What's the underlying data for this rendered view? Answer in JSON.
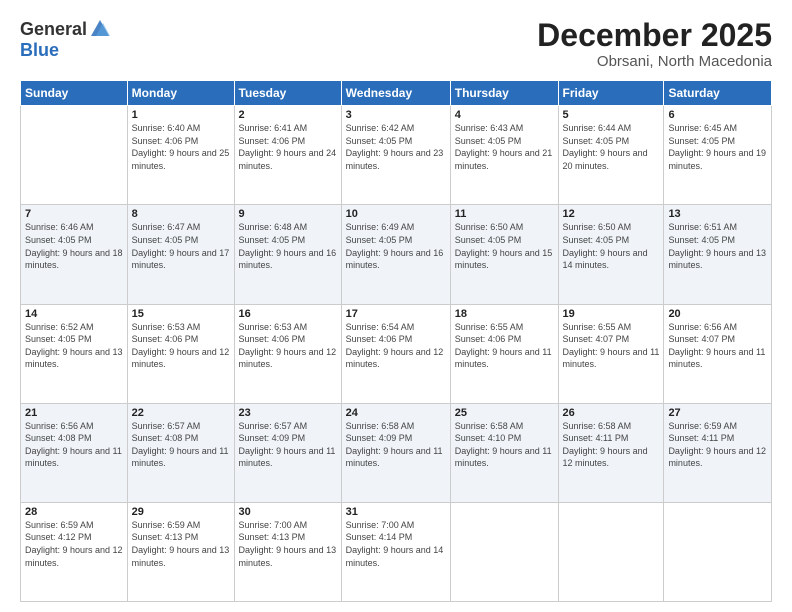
{
  "logo": {
    "general": "General",
    "blue": "Blue"
  },
  "header": {
    "month": "December 2025",
    "location": "Obrsani, North Macedonia"
  },
  "days_of_week": [
    "Sunday",
    "Monday",
    "Tuesday",
    "Wednesday",
    "Thursday",
    "Friday",
    "Saturday"
  ],
  "weeks": [
    [
      {
        "day": "",
        "sunrise": "",
        "sunset": "",
        "daylight": ""
      },
      {
        "day": "1",
        "sunrise": "Sunrise: 6:40 AM",
        "sunset": "Sunset: 4:06 PM",
        "daylight": "Daylight: 9 hours and 25 minutes."
      },
      {
        "day": "2",
        "sunrise": "Sunrise: 6:41 AM",
        "sunset": "Sunset: 4:06 PM",
        "daylight": "Daylight: 9 hours and 24 minutes."
      },
      {
        "day": "3",
        "sunrise": "Sunrise: 6:42 AM",
        "sunset": "Sunset: 4:05 PM",
        "daylight": "Daylight: 9 hours and 23 minutes."
      },
      {
        "day": "4",
        "sunrise": "Sunrise: 6:43 AM",
        "sunset": "Sunset: 4:05 PM",
        "daylight": "Daylight: 9 hours and 21 minutes."
      },
      {
        "day": "5",
        "sunrise": "Sunrise: 6:44 AM",
        "sunset": "Sunset: 4:05 PM",
        "daylight": "Daylight: 9 hours and 20 minutes."
      },
      {
        "day": "6",
        "sunrise": "Sunrise: 6:45 AM",
        "sunset": "Sunset: 4:05 PM",
        "daylight": "Daylight: 9 hours and 19 minutes."
      }
    ],
    [
      {
        "day": "7",
        "sunrise": "Sunrise: 6:46 AM",
        "sunset": "Sunset: 4:05 PM",
        "daylight": "Daylight: 9 hours and 18 minutes."
      },
      {
        "day": "8",
        "sunrise": "Sunrise: 6:47 AM",
        "sunset": "Sunset: 4:05 PM",
        "daylight": "Daylight: 9 hours and 17 minutes."
      },
      {
        "day": "9",
        "sunrise": "Sunrise: 6:48 AM",
        "sunset": "Sunset: 4:05 PM",
        "daylight": "Daylight: 9 hours and 16 minutes."
      },
      {
        "day": "10",
        "sunrise": "Sunrise: 6:49 AM",
        "sunset": "Sunset: 4:05 PM",
        "daylight": "Daylight: 9 hours and 16 minutes."
      },
      {
        "day": "11",
        "sunrise": "Sunrise: 6:50 AM",
        "sunset": "Sunset: 4:05 PM",
        "daylight": "Daylight: 9 hours and 15 minutes."
      },
      {
        "day": "12",
        "sunrise": "Sunrise: 6:50 AM",
        "sunset": "Sunset: 4:05 PM",
        "daylight": "Daylight: 9 hours and 14 minutes."
      },
      {
        "day": "13",
        "sunrise": "Sunrise: 6:51 AM",
        "sunset": "Sunset: 4:05 PM",
        "daylight": "Daylight: 9 hours and 13 minutes."
      }
    ],
    [
      {
        "day": "14",
        "sunrise": "Sunrise: 6:52 AM",
        "sunset": "Sunset: 4:05 PM",
        "daylight": "Daylight: 9 hours and 13 minutes."
      },
      {
        "day": "15",
        "sunrise": "Sunrise: 6:53 AM",
        "sunset": "Sunset: 4:06 PM",
        "daylight": "Daylight: 9 hours and 12 minutes."
      },
      {
        "day": "16",
        "sunrise": "Sunrise: 6:53 AM",
        "sunset": "Sunset: 4:06 PM",
        "daylight": "Daylight: 9 hours and 12 minutes."
      },
      {
        "day": "17",
        "sunrise": "Sunrise: 6:54 AM",
        "sunset": "Sunset: 4:06 PM",
        "daylight": "Daylight: 9 hours and 12 minutes."
      },
      {
        "day": "18",
        "sunrise": "Sunrise: 6:55 AM",
        "sunset": "Sunset: 4:06 PM",
        "daylight": "Daylight: 9 hours and 11 minutes."
      },
      {
        "day": "19",
        "sunrise": "Sunrise: 6:55 AM",
        "sunset": "Sunset: 4:07 PM",
        "daylight": "Daylight: 9 hours and 11 minutes."
      },
      {
        "day": "20",
        "sunrise": "Sunrise: 6:56 AM",
        "sunset": "Sunset: 4:07 PM",
        "daylight": "Daylight: 9 hours and 11 minutes."
      }
    ],
    [
      {
        "day": "21",
        "sunrise": "Sunrise: 6:56 AM",
        "sunset": "Sunset: 4:08 PM",
        "daylight": "Daylight: 9 hours and 11 minutes."
      },
      {
        "day": "22",
        "sunrise": "Sunrise: 6:57 AM",
        "sunset": "Sunset: 4:08 PM",
        "daylight": "Daylight: 9 hours and 11 minutes."
      },
      {
        "day": "23",
        "sunrise": "Sunrise: 6:57 AM",
        "sunset": "Sunset: 4:09 PM",
        "daylight": "Daylight: 9 hours and 11 minutes."
      },
      {
        "day": "24",
        "sunrise": "Sunrise: 6:58 AM",
        "sunset": "Sunset: 4:09 PM",
        "daylight": "Daylight: 9 hours and 11 minutes."
      },
      {
        "day": "25",
        "sunrise": "Sunrise: 6:58 AM",
        "sunset": "Sunset: 4:10 PM",
        "daylight": "Daylight: 9 hours and 11 minutes."
      },
      {
        "day": "26",
        "sunrise": "Sunrise: 6:58 AM",
        "sunset": "Sunset: 4:11 PM",
        "daylight": "Daylight: 9 hours and 12 minutes."
      },
      {
        "day": "27",
        "sunrise": "Sunrise: 6:59 AM",
        "sunset": "Sunset: 4:11 PM",
        "daylight": "Daylight: 9 hours and 12 minutes."
      }
    ],
    [
      {
        "day": "28",
        "sunrise": "Sunrise: 6:59 AM",
        "sunset": "Sunset: 4:12 PM",
        "daylight": "Daylight: 9 hours and 12 minutes."
      },
      {
        "day": "29",
        "sunrise": "Sunrise: 6:59 AM",
        "sunset": "Sunset: 4:13 PM",
        "daylight": "Daylight: 9 hours and 13 minutes."
      },
      {
        "day": "30",
        "sunrise": "Sunrise: 7:00 AM",
        "sunset": "Sunset: 4:13 PM",
        "daylight": "Daylight: 9 hours and 13 minutes."
      },
      {
        "day": "31",
        "sunrise": "Sunrise: 7:00 AM",
        "sunset": "Sunset: 4:14 PM",
        "daylight": "Daylight: 9 hours and 14 minutes."
      },
      {
        "day": "",
        "sunrise": "",
        "sunset": "",
        "daylight": ""
      },
      {
        "day": "",
        "sunrise": "",
        "sunset": "",
        "daylight": ""
      },
      {
        "day": "",
        "sunrise": "",
        "sunset": "",
        "daylight": ""
      }
    ]
  ]
}
